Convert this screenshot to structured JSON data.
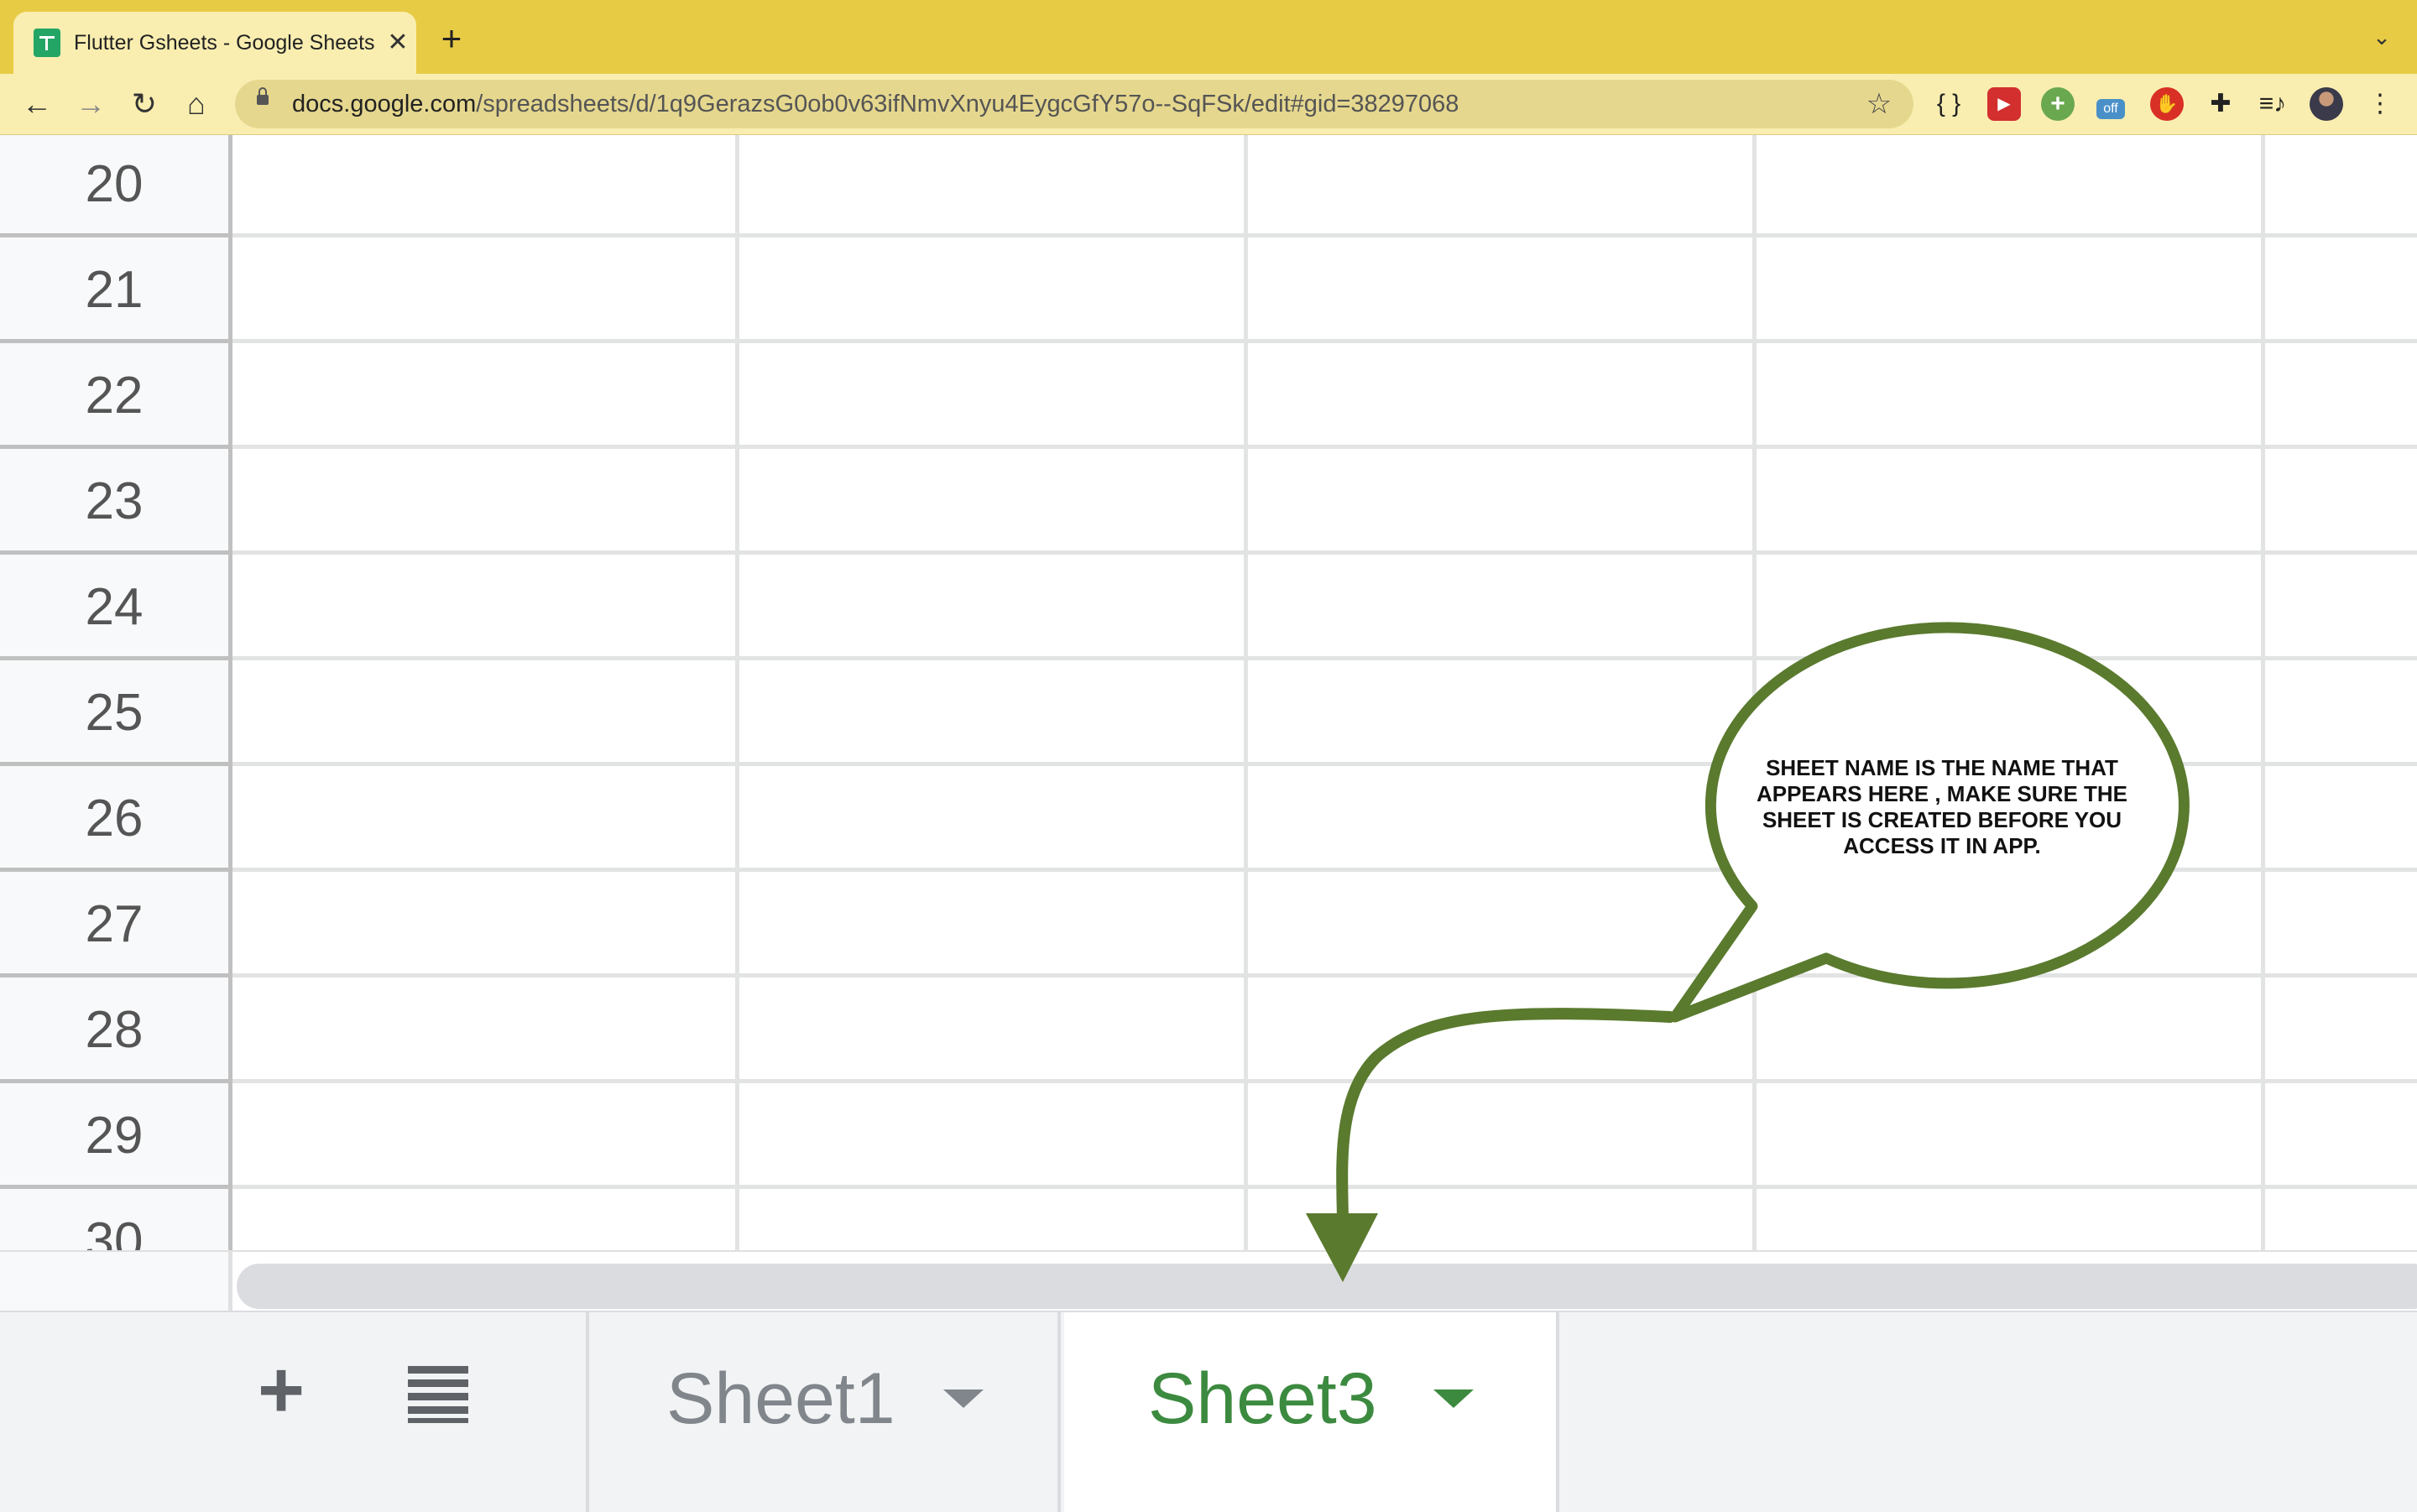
{
  "browser": {
    "tab_title": "Flutter Gsheets - Google Sheets",
    "tab_close": "✕",
    "new_tab": "+",
    "tab_menu": "⌄",
    "url_domain": "docs.google.com",
    "url_path": "/spreadsheets/d/1q9GerazsG0ob0v63ifNmvXnyu4EygcGfY57o--SqFSk/edit#gid=38297068",
    "nav": {
      "back": "←",
      "forward": "→",
      "reload": "↻",
      "home": "⌂"
    },
    "star": "☆",
    "extensions": [
      {
        "name": "json-formatter-icon",
        "glyph": "{ }"
      },
      {
        "name": "video-speed-icon",
        "glyph": "▶"
      },
      {
        "name": "green-plus-icon",
        "glyph": "+"
      },
      {
        "name": "off-badge-icon",
        "glyph": "off"
      },
      {
        "name": "stop-hand-icon",
        "glyph": "✋"
      },
      {
        "name": "puzzle-icon",
        "glyph": "✚"
      },
      {
        "name": "media-queue-icon",
        "glyph": "≡♪"
      },
      {
        "name": "profile-avatar",
        "glyph": ""
      },
      {
        "name": "kebab-menu-icon",
        "glyph": "⋮"
      }
    ]
  },
  "grid": {
    "row_numbers": [
      "20",
      "21",
      "22",
      "23",
      "24",
      "25",
      "26",
      "27",
      "28",
      "29",
      "30"
    ]
  },
  "sheet_bar": {
    "add_sheet": "+",
    "tabs": [
      {
        "label": "Sheet1",
        "active": false
      },
      {
        "label": "Sheet3",
        "active": true
      }
    ]
  },
  "annotation": {
    "callout_text": "SHEET NAME IS THE NAME THAT APPEARS HERE , MAKE SURE THE SHEET IS CREATED BEFORE YOU ACCESS IT IN APP.",
    "color": "#5a7a2e"
  },
  "colors": {
    "chrome_yellow": "#e8cb45",
    "toolbar_yellow": "#f9eeb0",
    "active_tab_green": "#3c8a3f",
    "row_header_bg": "#f8f9fa"
  }
}
